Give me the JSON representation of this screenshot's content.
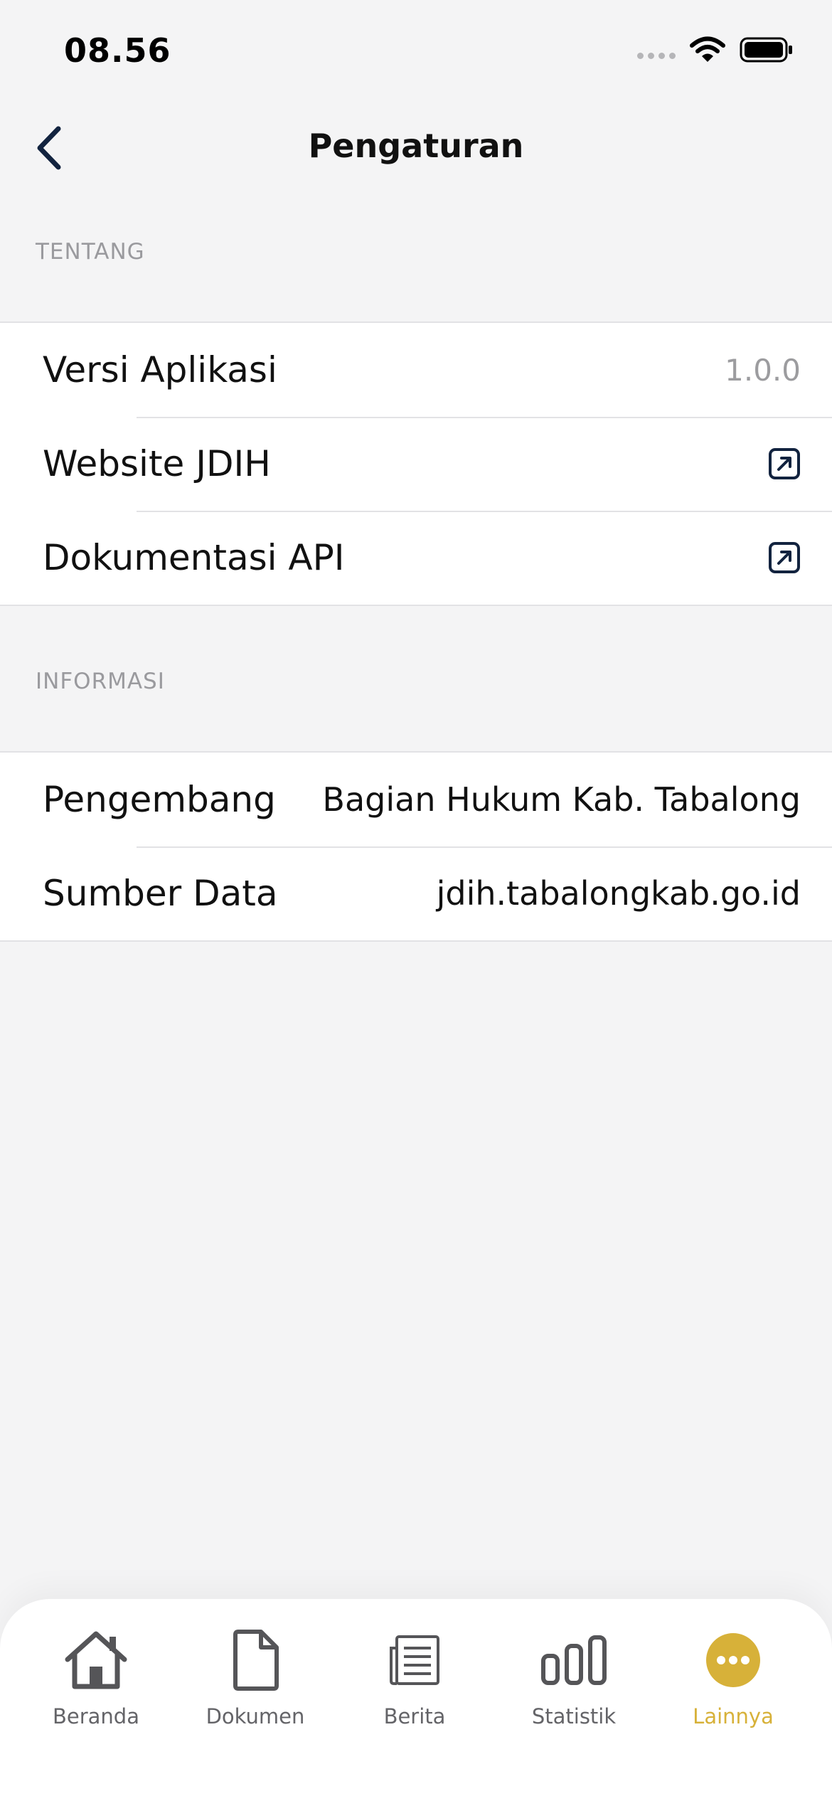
{
  "status_bar": {
    "time": "08.56"
  },
  "nav": {
    "title": "Pengaturan"
  },
  "sections": [
    {
      "header": "TENTANG",
      "rows": [
        {
          "label": "Versi Aplikasi",
          "value": "1.0.0",
          "type": "value"
        },
        {
          "label": "Website JDIH",
          "type": "external-link",
          "icon": "external-link-icon"
        },
        {
          "label": "Dokumentasi API",
          "type": "external-link",
          "icon": "external-link-icon"
        }
      ]
    },
    {
      "header": "INFORMASI",
      "rows": [
        {
          "label": "Pengembang",
          "value": "Bagian Hukum Kab. Tabalong",
          "type": "value"
        },
        {
          "label": "Sumber Data",
          "value": "jdih.tabalongkab.go.id",
          "type": "value"
        }
      ]
    }
  ],
  "tab_bar": {
    "items": [
      {
        "label": "Beranda",
        "icon": "home-icon"
      },
      {
        "label": "Dokumen",
        "icon": "document-icon"
      },
      {
        "label": "Berita",
        "icon": "news-icon"
      },
      {
        "label": "Statistik",
        "icon": "bar-chart-icon"
      },
      {
        "label": "Lainnya",
        "icon": "more-icon"
      }
    ],
    "active_index": 4
  },
  "colors": {
    "accent": "#d7b139",
    "background": "#f4f4f5",
    "navy": "#12233f",
    "muted_text": "#9a9a9e"
  }
}
